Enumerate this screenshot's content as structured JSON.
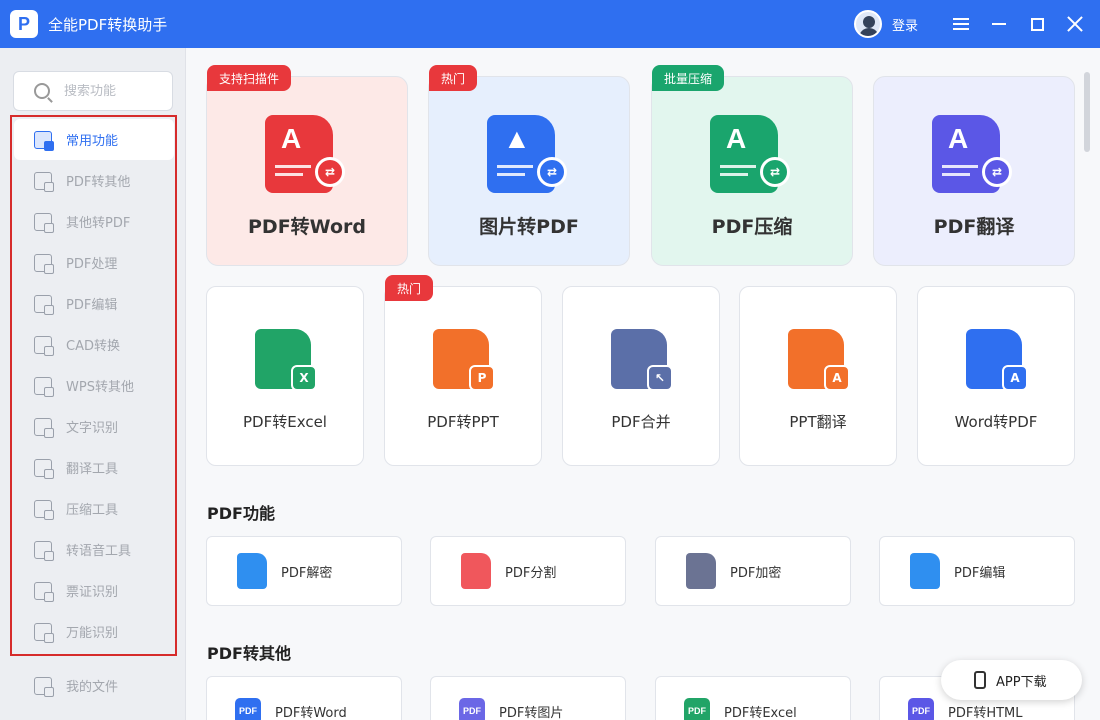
{
  "titlebar": {
    "app_title": "全能PDF转换助手",
    "logo_glyph": "P",
    "login_label": "登录"
  },
  "sidebar": {
    "search_placeholder": "搜索功能",
    "items": [
      {
        "label": "常用功能",
        "icon": "grid-icon",
        "active": true
      },
      {
        "label": "PDF转其他",
        "icon": "pdf-convert-icon"
      },
      {
        "label": "其他转PDF",
        "icon": "to-pdf-icon"
      },
      {
        "label": "PDF处理",
        "icon": "pdf-process-icon"
      },
      {
        "label": "PDF编辑",
        "icon": "pdf-edit-icon"
      },
      {
        "label": "CAD转换",
        "icon": "cad-icon"
      },
      {
        "label": "WPS转其他",
        "icon": "wps-icon"
      },
      {
        "label": "文字识别",
        "icon": "ocr-icon"
      },
      {
        "label": "翻译工具",
        "icon": "translate-icon"
      },
      {
        "label": "压缩工具",
        "icon": "zip-icon"
      },
      {
        "label": "转语音工具",
        "icon": "speech-icon"
      },
      {
        "label": "票证识别",
        "icon": "ticket-icon"
      },
      {
        "label": "万能识别",
        "icon": "scan-icon"
      }
    ],
    "my_files": "我的文件"
  },
  "featured": [
    {
      "title": "PDF转Word",
      "tag": "支持扫描件",
      "tag_color": "red",
      "bg": "#fde9e7",
      "icon_color": "#e8383c",
      "glyph": "A"
    },
    {
      "title": "图片转PDF",
      "tag": "热门",
      "tag_color": "red",
      "bg": "#e6effd",
      "icon_color": "#2f6ff0",
      "glyph": "▲"
    },
    {
      "title": "PDF压缩",
      "tag": "批量压缩",
      "tag_color": "green",
      "bg": "#e2f6ee",
      "icon_color": "#1aa56d",
      "glyph": "A"
    },
    {
      "title": "PDF翻译",
      "tag": "",
      "tag_color": "",
      "bg": "#eceefd",
      "icon_color": "#5b57e6",
      "glyph": "A"
    }
  ],
  "tools": [
    {
      "title": "PDF转Excel",
      "tag": "",
      "icon_color": "#21a467",
      "badge": "X"
    },
    {
      "title": "PDF转PPT",
      "tag": "热门",
      "icon_color": "#f2702a",
      "badge": "P"
    },
    {
      "title": "PDF合并",
      "tag": "",
      "icon_color": "#5b6fa8",
      "badge": "↖"
    },
    {
      "title": "PPT翻译",
      "tag": "",
      "icon_color": "#f2702a",
      "badge": "A"
    },
    {
      "title": "Word转PDF",
      "tag": "",
      "icon_color": "#2f6ff0",
      "badge": "A"
    }
  ],
  "sections": [
    {
      "title": "PDF功能",
      "items": [
        {
          "label": "PDF解密",
          "icon": "unlock-icon",
          "color": "#2f8ff0"
        },
        {
          "label": "PDF分割",
          "icon": "split-icon",
          "color": "#f0575c"
        },
        {
          "label": "PDF加密",
          "icon": "lock-icon",
          "color": "#6b7393"
        },
        {
          "label": "PDF编辑",
          "icon": "edit-icon",
          "color": "#2f8ff0"
        }
      ]
    },
    {
      "title": "PDF转其他",
      "items": [
        {
          "label": "PDF转Word",
          "icon": "pdf-word-icon",
          "color": "#2f6ff0"
        },
        {
          "label": "PDF转图片",
          "icon": "pdf-image-icon",
          "color": "#6b67e6"
        },
        {
          "label": "PDF转Excel",
          "icon": "pdf-excel-icon",
          "color": "#21a467"
        },
        {
          "label": "PDF转HTML",
          "icon": "pdf-html-icon",
          "color": "#5b57e6"
        }
      ]
    }
  ],
  "app_download": "APP下载",
  "pdf_badge_text": "PDF"
}
